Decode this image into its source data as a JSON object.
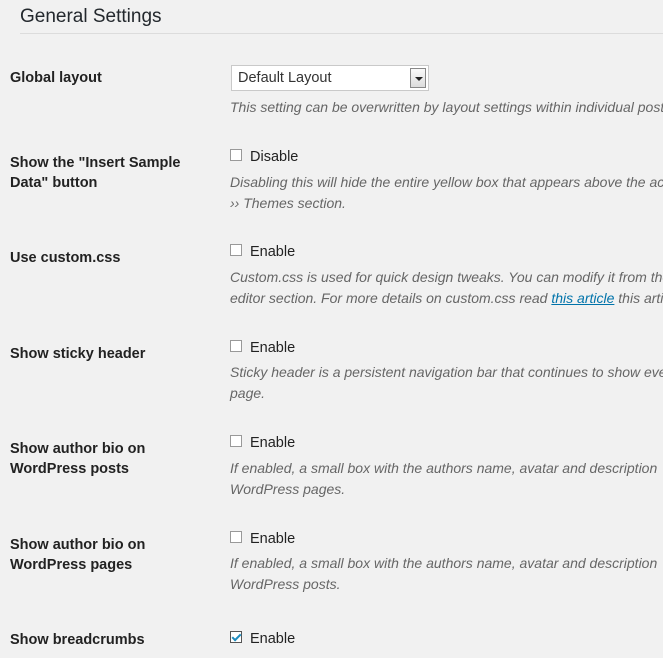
{
  "section": {
    "title": "General Settings"
  },
  "global_layout": {
    "label": "Global layout",
    "selected": "Default Layout",
    "description": "This setting can be overwritten by layout settings within individual posts."
  },
  "sample_data": {
    "label": "Show the \"Insert Sample Data\" button",
    "option": "Disable",
    "checked": false,
    "description_line1": "Disabling this will hide the entire yellow box that appears above the active",
    "description_line2": "›› Themes section."
  },
  "custom_css": {
    "label": "Use custom.css",
    "option": "Enable",
    "checked": false,
    "description_line1": "Custom.css is used for quick design tweaks. You can modify it from the",
    "description_line2_before": "editor section. For more details on custom.css read ",
    "description_link": "this article",
    "description_line2_after": " this article"
  },
  "sticky_header": {
    "label": "Show sticky header",
    "option": "Enable",
    "checked": false,
    "description_line1": "Sticky header is a persistent navigation bar that continues to show even",
    "description_line2": "page."
  },
  "author_bio_posts": {
    "label": "Show author bio on WordPress posts",
    "option": "Enable",
    "checked": false,
    "description_line1": "If enabled, a small box with the authors name, avatar and description",
    "description_line2": "WordPress pages."
  },
  "author_bio_pages": {
    "label": "Show author bio on WordPress pages",
    "option": "Enable",
    "checked": false,
    "description_line1": "If enabled, a small box with the authors name, avatar and description",
    "description_line2": "WordPress posts."
  },
  "breadcrumbs": {
    "label": "Show breadcrumbs",
    "option": "Enable",
    "checked": true
  },
  "colors": {
    "link": "#0073aa",
    "checkmark": "#1e8cbe"
  }
}
